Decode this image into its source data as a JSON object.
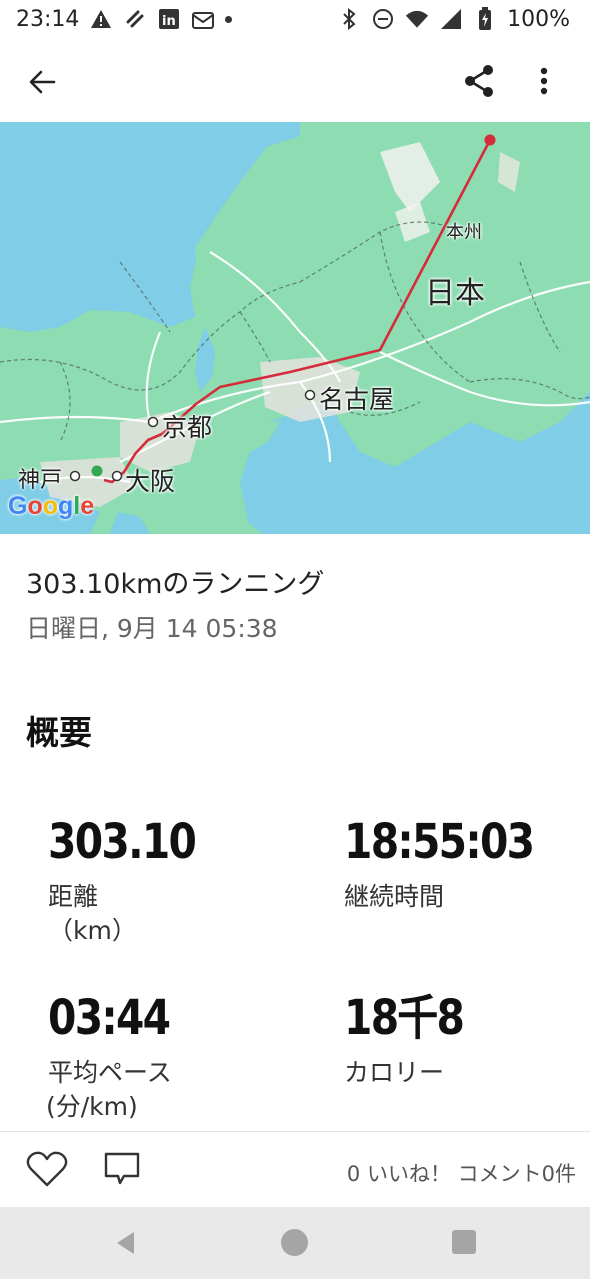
{
  "status_bar": {
    "time": "23:14",
    "battery": "100%"
  },
  "app_bar": {
    "back_icon": "arrow-back-icon",
    "share_icon": "share-icon",
    "more_icon": "more-vert-icon"
  },
  "map": {
    "labels": {
      "honshu": "本州",
      "japan": "日本",
      "nagoya": "名古屋",
      "kyoto": "京都",
      "kobe": "神戸",
      "osaka": "大阪"
    },
    "attribution": "Google",
    "route_color": "#d62b3a",
    "start_color": "#34a853",
    "water_color": "#7fcde6",
    "land_color": "#8ddcb2"
  },
  "activity": {
    "title": "303.10kmのランニング",
    "date": "日曜日, 9月 14 05:38"
  },
  "summary": {
    "heading": "概要",
    "stats": [
      {
        "value": "303.10",
        "label": "距離",
        "unit": "（km）"
      },
      {
        "value": "18:55:03",
        "label": "継続時間",
        "unit": ""
      },
      {
        "value": "03:44",
        "label": "平均ペース",
        "unit": "(分/km)"
      },
      {
        "value": "18千8",
        "label": "カロリー",
        "unit": ""
      }
    ]
  },
  "actions": {
    "like_icon": "heart-outline-icon",
    "comment_icon": "comment-icon",
    "counts": "0 いいね！ コメント0件"
  },
  "nav_bar": {
    "back_icon": "nav-back-icon",
    "home_icon": "nav-home-icon",
    "recent_icon": "nav-recent-icon"
  }
}
